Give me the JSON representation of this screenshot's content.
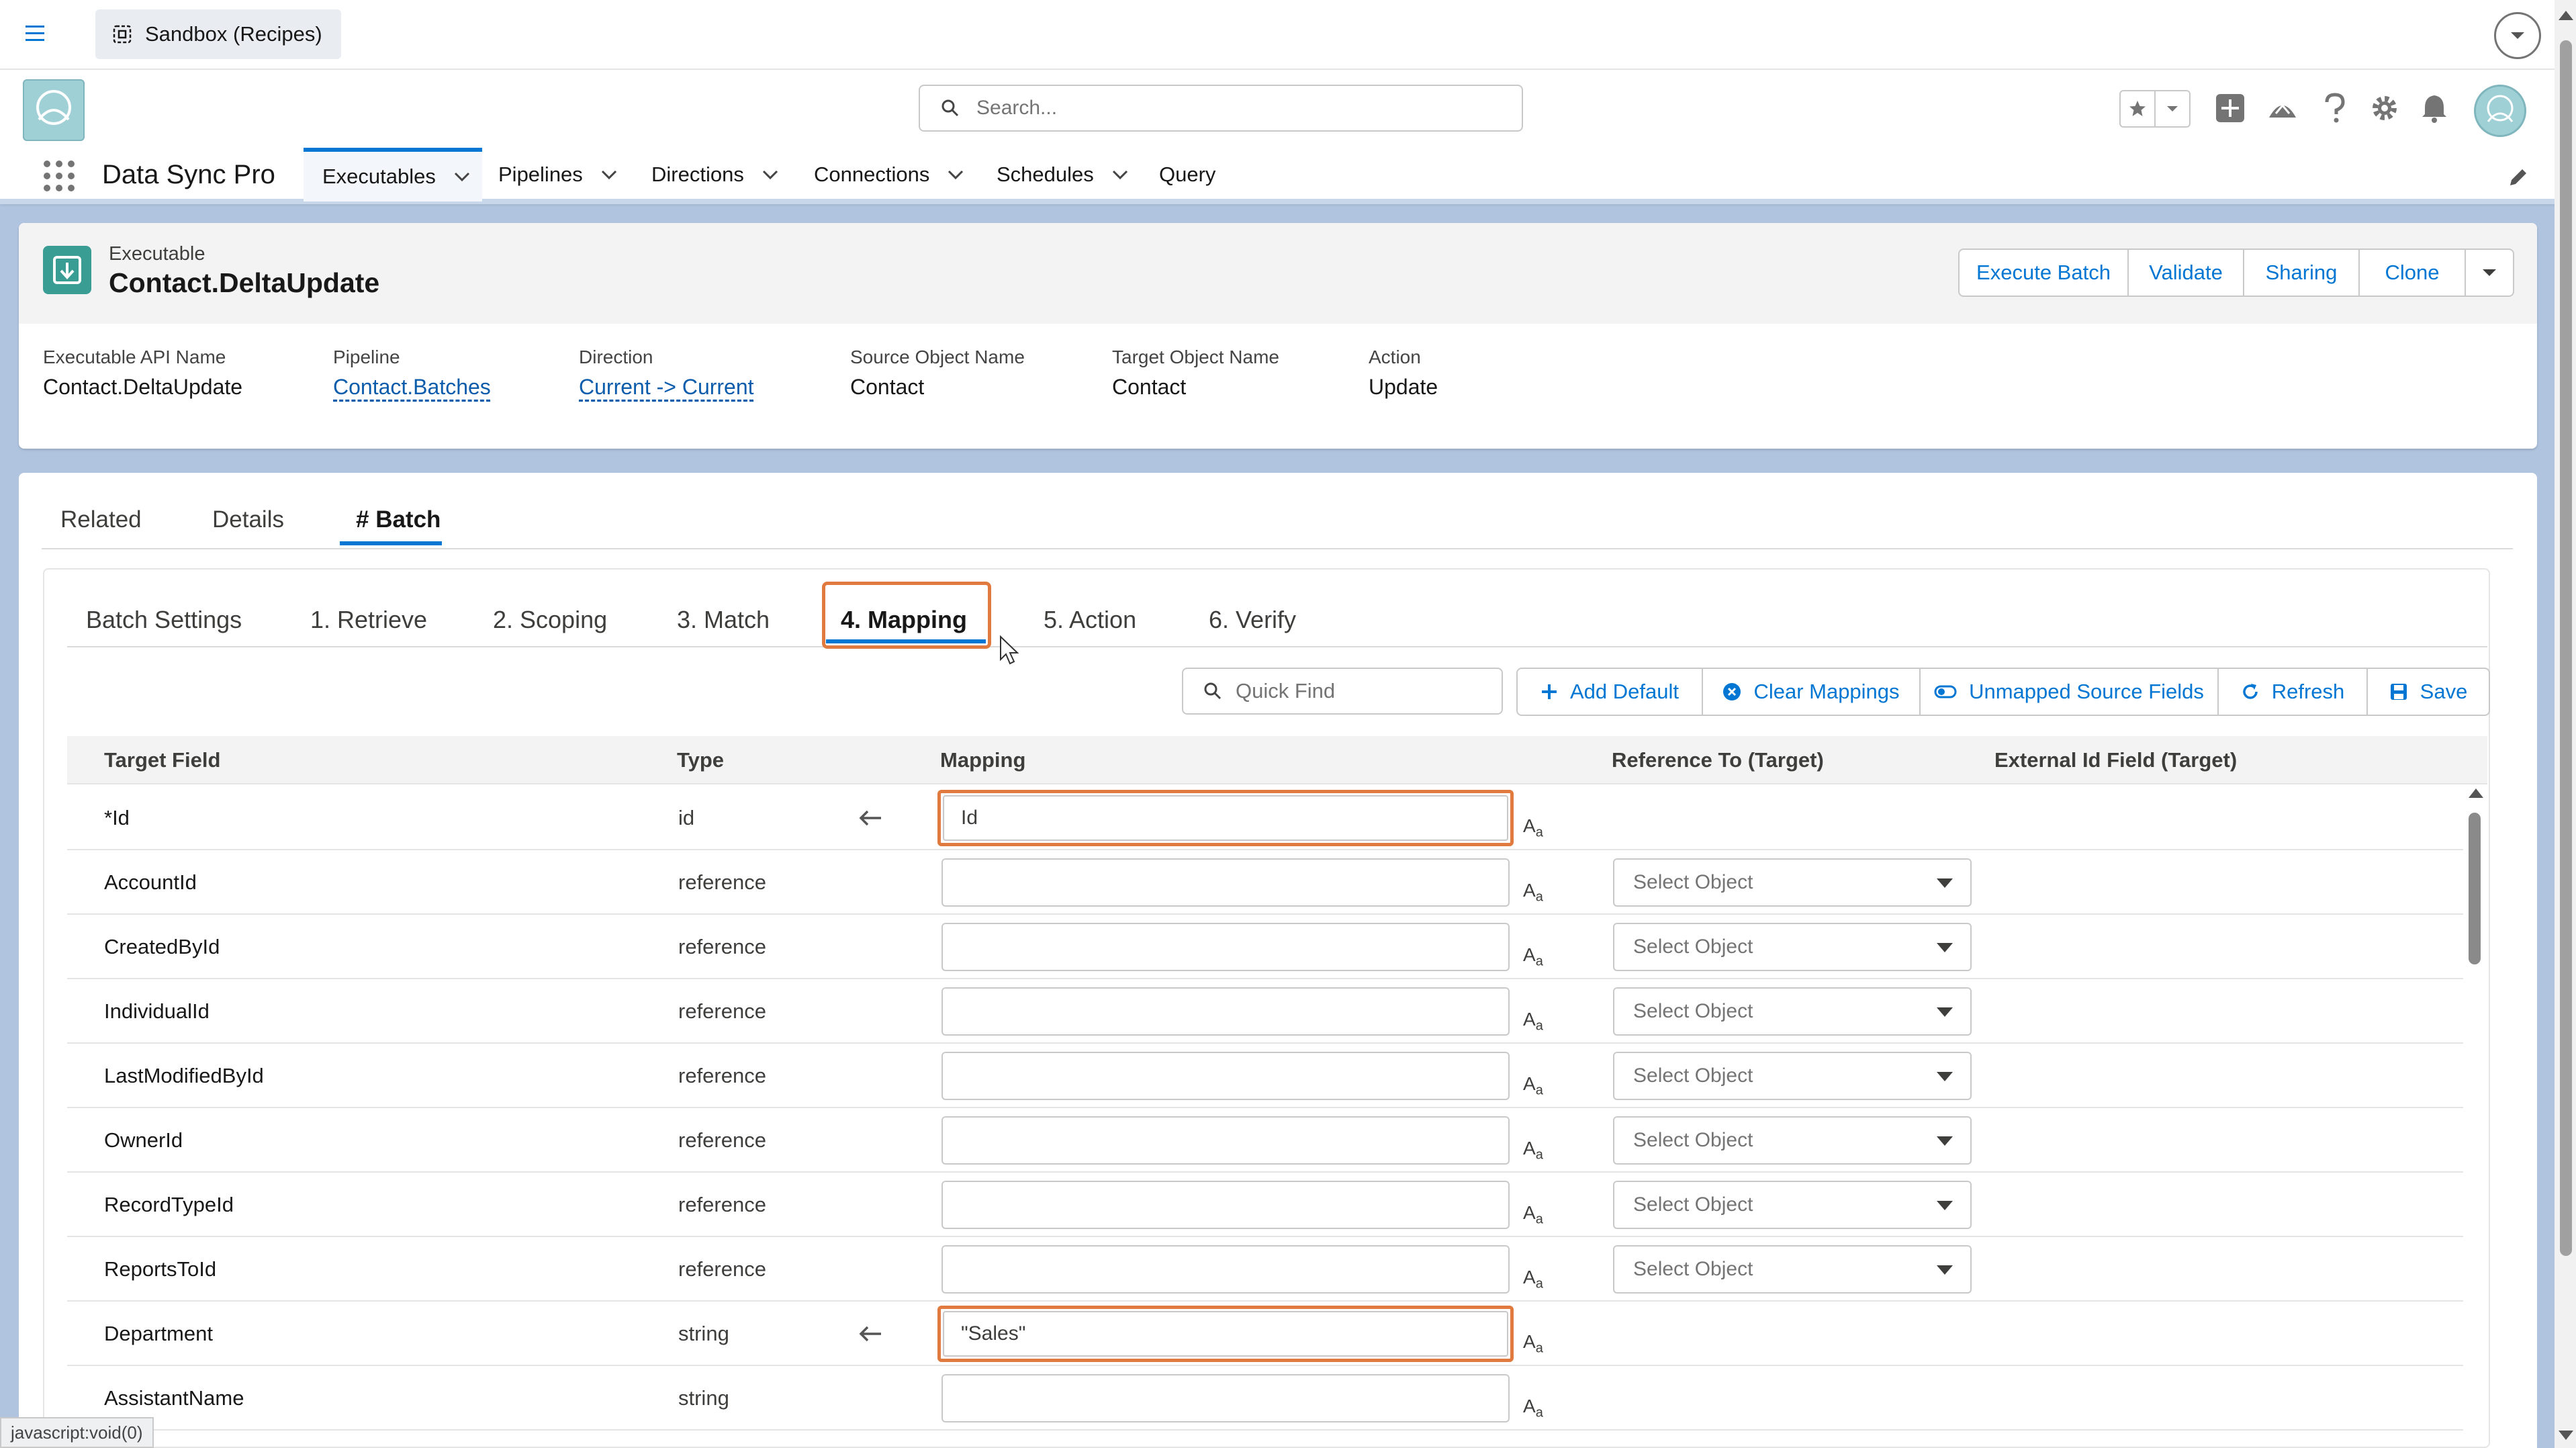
{
  "topbar": {
    "sandbox_label": "Sandbox (Recipes)"
  },
  "header": {
    "search_placeholder": "Search..."
  },
  "nav": {
    "app_name": "Data Sync Pro",
    "items": [
      {
        "label": "Executables"
      },
      {
        "label": "Pipelines"
      },
      {
        "label": "Directions"
      },
      {
        "label": "Connections"
      },
      {
        "label": "Schedules"
      },
      {
        "label": "Query"
      }
    ]
  },
  "record": {
    "type_label": "Executable",
    "title": "Contact.DeltaUpdate",
    "actions": [
      "Execute Batch",
      "Validate",
      "Sharing",
      "Clone"
    ],
    "highlights": [
      {
        "label": "Executable API Name",
        "value": "Contact.DeltaUpdate"
      },
      {
        "label": "Pipeline",
        "value": "Contact.Batches"
      },
      {
        "label": "Direction",
        "value": "Current -> Current"
      },
      {
        "label": "Source Object Name",
        "value": "Contact"
      },
      {
        "label": "Target Object Name",
        "value": "Contact"
      },
      {
        "label": "Action",
        "value": "Update"
      }
    ]
  },
  "main_tabs": [
    {
      "label": "Related"
    },
    {
      "label": "Details"
    },
    {
      "label": "# Batch"
    }
  ],
  "sub_tabs": [
    {
      "label": "Batch Settings"
    },
    {
      "label": "1. Retrieve"
    },
    {
      "label": "2. Scoping"
    },
    {
      "label": "3. Match"
    },
    {
      "label": "4. Mapping"
    },
    {
      "label": "5. Action"
    },
    {
      "label": "6. Verify"
    }
  ],
  "toolbar": {
    "quickfind_placeholder": "Quick Find",
    "buttons": [
      "Add Default",
      "Clear Mappings",
      "Unmapped Source Fields",
      "Refresh",
      "Save"
    ]
  },
  "table": {
    "headers": [
      "Target Field",
      "Type",
      "Mapping",
      "Reference To (Target)",
      "External Id Field (Target)"
    ],
    "select_placeholder": "Select Object",
    "format_icon_label": "A",
    "format_icon_sub": "a",
    "arrow_glyph": "←",
    "rows": [
      {
        "field": "*Id",
        "type": "id",
        "mapping": "Id"
      },
      {
        "field": "AccountId",
        "type": "reference",
        "mapping": ""
      },
      {
        "field": "CreatedById",
        "type": "reference",
        "mapping": ""
      },
      {
        "field": "IndividualId",
        "type": "reference",
        "mapping": ""
      },
      {
        "field": "LastModifiedById",
        "type": "reference",
        "mapping": ""
      },
      {
        "field": "OwnerId",
        "type": "reference",
        "mapping": ""
      },
      {
        "field": "RecordTypeId",
        "type": "reference",
        "mapping": ""
      },
      {
        "field": "ReportsToId",
        "type": "reference",
        "mapping": ""
      },
      {
        "field": "Department",
        "type": "string",
        "mapping": "\"Sales\""
      },
      {
        "field": "AssistantName",
        "type": "string",
        "mapping": ""
      }
    ]
  },
  "status_bar": {
    "url": "javascript:void(0)"
  },
  "colors": {
    "brand_blue": "#0176d3",
    "highlight_orange": "#e07a3f",
    "link_blue": "#0b5cab"
  }
}
